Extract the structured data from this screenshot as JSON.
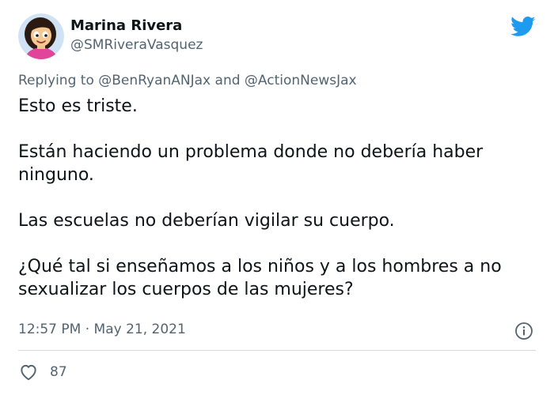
{
  "author": {
    "display_name": "Marina Rivera",
    "handle": "@SMRiveraVasquez",
    "avatar": "cartoon-avatar"
  },
  "reply_context": {
    "prefix": "Replying to",
    "mention_1": "@BenRyanANJax",
    "joiner": "and",
    "mention_2": "@ActionNewsJax"
  },
  "body": {
    "paragraphs": [
      "Esto es triste.",
      "Están haciendo un problema donde no debería haber ninguno.",
      "Las escuelas no deberían vigilar su cuerpo.",
      "¿Qué tal si enseñamos a los niños y a los hombres a no sexualizar los cuerpos de las mujeres?"
    ]
  },
  "meta": {
    "timestamp": "12:57 PM · May 21, 2021"
  },
  "engagement": {
    "likes": "87"
  },
  "icons": {
    "brand": "twitter-bird-icon",
    "info": "info-icon",
    "like": "heart-icon"
  },
  "colors": {
    "brand": "#1d9bf0",
    "text": "#0f1419",
    "secondary": "#536471",
    "divider": "#cfd9de"
  }
}
